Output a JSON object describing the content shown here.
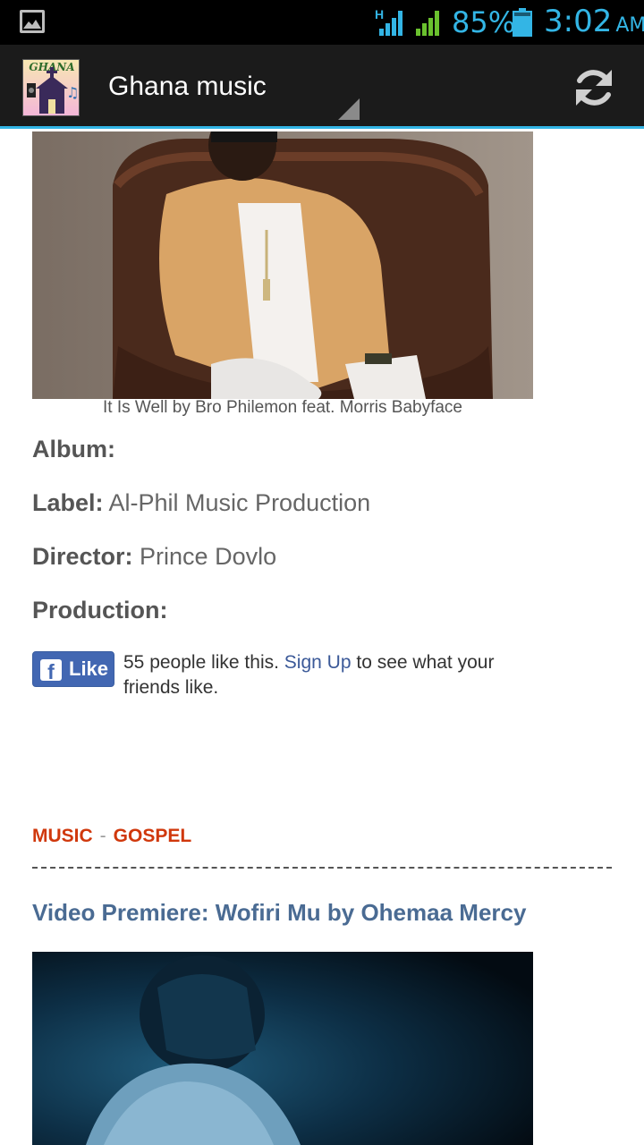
{
  "status_bar": {
    "battery_percent": "85%",
    "time": "3:02",
    "ampm": "AM",
    "network_type": "H",
    "accent_color": "#33b5e5"
  },
  "action_bar": {
    "app_icon_text": "GHANA",
    "title": "Ghana music",
    "refresh_icon": "refresh-icon"
  },
  "article1": {
    "caption": "It Is Well by Bro Philemon feat. Morris Babyface",
    "album_label": "Album:",
    "album_value": "",
    "label_label": "Label:",
    "label_value": "Al-Phil Music Production",
    "director_label": "Director:",
    "director_value": "Prince Dovlo",
    "production_label": "Production:",
    "production_value": ""
  },
  "facebook": {
    "button_label": "Like",
    "text_before": "55 people like this.",
    "signup_link": "Sign Up",
    "text_after": "to see what your friends like."
  },
  "article2": {
    "category1": "MUSIC",
    "separator": "-",
    "category2": "GOSPEL",
    "headline": "Video Premiere: Wofiri Mu by Ohemaa Mercy"
  }
}
